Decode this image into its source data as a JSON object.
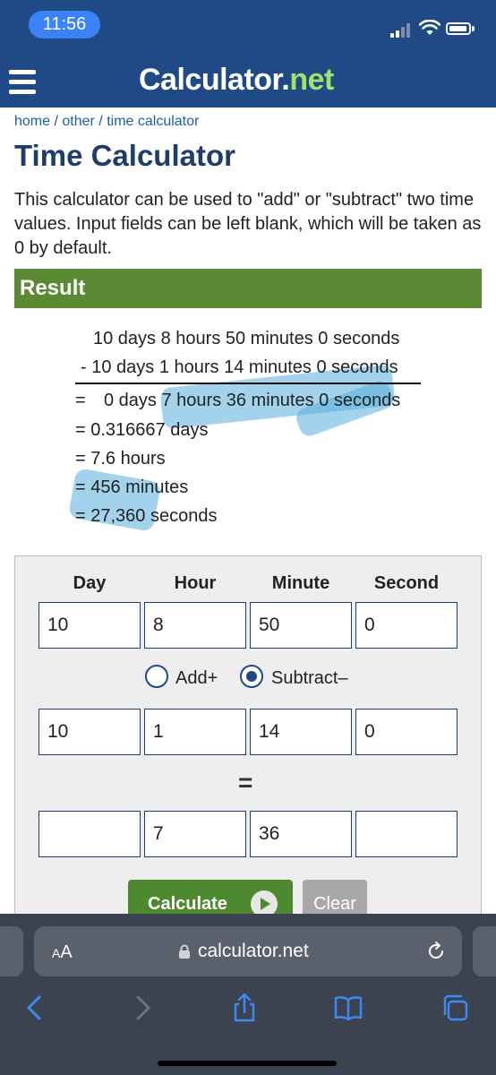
{
  "status_bar": {
    "time": "11:56"
  },
  "site": {
    "logo_main": "Calculator",
    "logo_dot": ".",
    "logo_net": "net",
    "breadcrumb": [
      {
        "label": "home"
      },
      {
        "label": "other"
      },
      {
        "label": "time calculator"
      }
    ],
    "breadcrumb_sep": " / ",
    "title": "Time Calculator",
    "intro": "This calculator can be used to \"add\" or \"subtract\" two time values. Input fields can be left blank, which will be taken as 0 by default."
  },
  "result": {
    "heading": "Result",
    "line1": "10 days 8 hours 50 minutes 0 seconds",
    "line2": "- 10 days 1 hours 14 minutes 0 seconds",
    "line3_eq": "=",
    "line3": "0 days 7 hours 36 minutes 0 seconds",
    "line4": "= 0.316667 days",
    "line5": "= 7.6 hours",
    "line6": "= 456 minutes",
    "line7": "= 27,360 seconds",
    "highlight_color": "#58afdc"
  },
  "form": {
    "headers": [
      "Day",
      "Hour",
      "Minute",
      "Second"
    ],
    "row1": [
      "10",
      "8",
      "50",
      "0"
    ],
    "row2": [
      "10",
      "1",
      "14",
      "0"
    ],
    "row3": [
      "",
      "7",
      "36",
      ""
    ],
    "add_label": "Add+",
    "subtract_label": "Subtract–",
    "selected_operation": "subtract",
    "equals": "=",
    "calculate_label": "Calculate",
    "clear_label": "Clear"
  },
  "browser": {
    "aa_big": "A",
    "aa_small": "A",
    "url": "calculator.net"
  },
  "colors": {
    "header_bg": "#1f4a86",
    "result_bar": "#5b8a34",
    "calculate_btn": "#4d8a2f",
    "logo_net": "#a6e06a"
  }
}
